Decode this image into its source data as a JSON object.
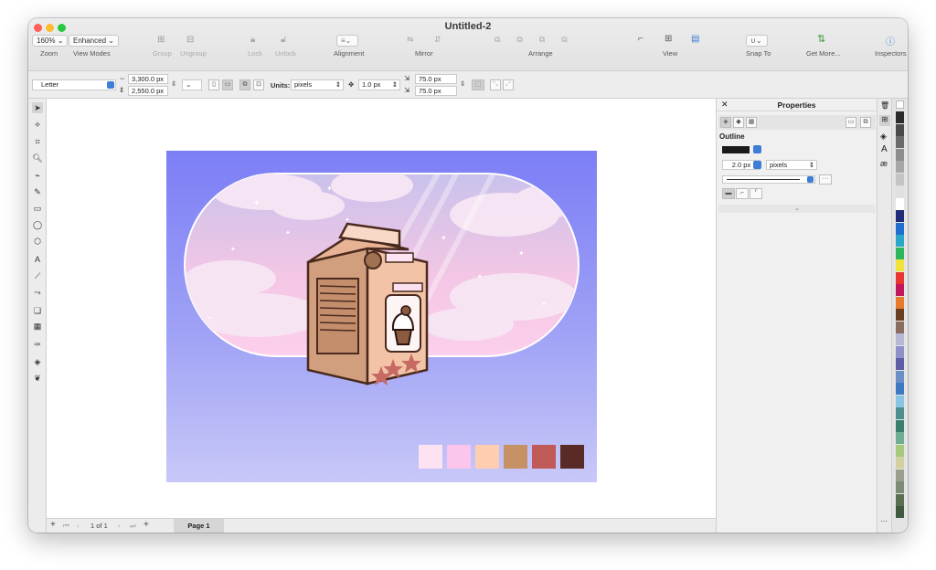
{
  "window": {
    "title": "Untitled-2"
  },
  "toolbar": {
    "zoom_value": "160%",
    "view_mode_value": "Enhanced",
    "labels": {
      "zoom": "Zoom",
      "view_modes": "View Modes",
      "group": "Group",
      "ungroup": "Ungroup",
      "lock": "Lock",
      "unlock": "Unlock",
      "alignment": "Alignment",
      "mirror": "Mirror",
      "arrange": "Arrange",
      "view": "View",
      "snap_to": "Snap To",
      "get_more": "Get More...",
      "inspectors": "Inspectors"
    }
  },
  "propbar": {
    "page_size": "Letter",
    "width": "3,300.0 px",
    "height": "2,550.0 px",
    "units_label": "Units:",
    "units_value": "pixels",
    "nudge": "1.0 px",
    "dup_x": "75.0 px",
    "dup_y": "75.0 px"
  },
  "status": {
    "page_of": "1 of 1",
    "page_tab": "Page 1"
  },
  "properties": {
    "title": "Properties",
    "section": "Outline",
    "width_value": "2.0 px",
    "units_value": "pixels"
  },
  "inspectors": {
    "icons": [
      "trash-icon",
      "layers-icon",
      "text-icon",
      "glyph-icon"
    ]
  },
  "palette_colors": [
    "#2b2b2b",
    "#4a4a4a",
    "#6b6b6b",
    "#8c8c8c",
    "#a7a7a7",
    "#c4c4c4",
    "#e0e0e0",
    "#ffffff",
    "#1f2a7a",
    "#1e6fd0",
    "#2aa7c8",
    "#2db55d",
    "#f1e23a",
    "#e8372f",
    "#c2185b",
    "#e87a2b",
    "#6b3e22",
    "#8a6d5c",
    "#b7b7d6",
    "#8f8fc9",
    "#5e5ea8",
    "#6a8ec7",
    "#3c79c0",
    "#89c4e6",
    "#4d8f8f",
    "#3b7e70",
    "#6fae92",
    "#a6c97c",
    "#d2d2a0",
    "#9aa08c",
    "#7d8a74",
    "#58704f",
    "#3f5a3f"
  ],
  "artboard_swatches": [
    "#fde2f1",
    "#fbc5ec",
    "#ffceb0",
    "#c79166",
    "#c05a57",
    "#5a2a26"
  ]
}
